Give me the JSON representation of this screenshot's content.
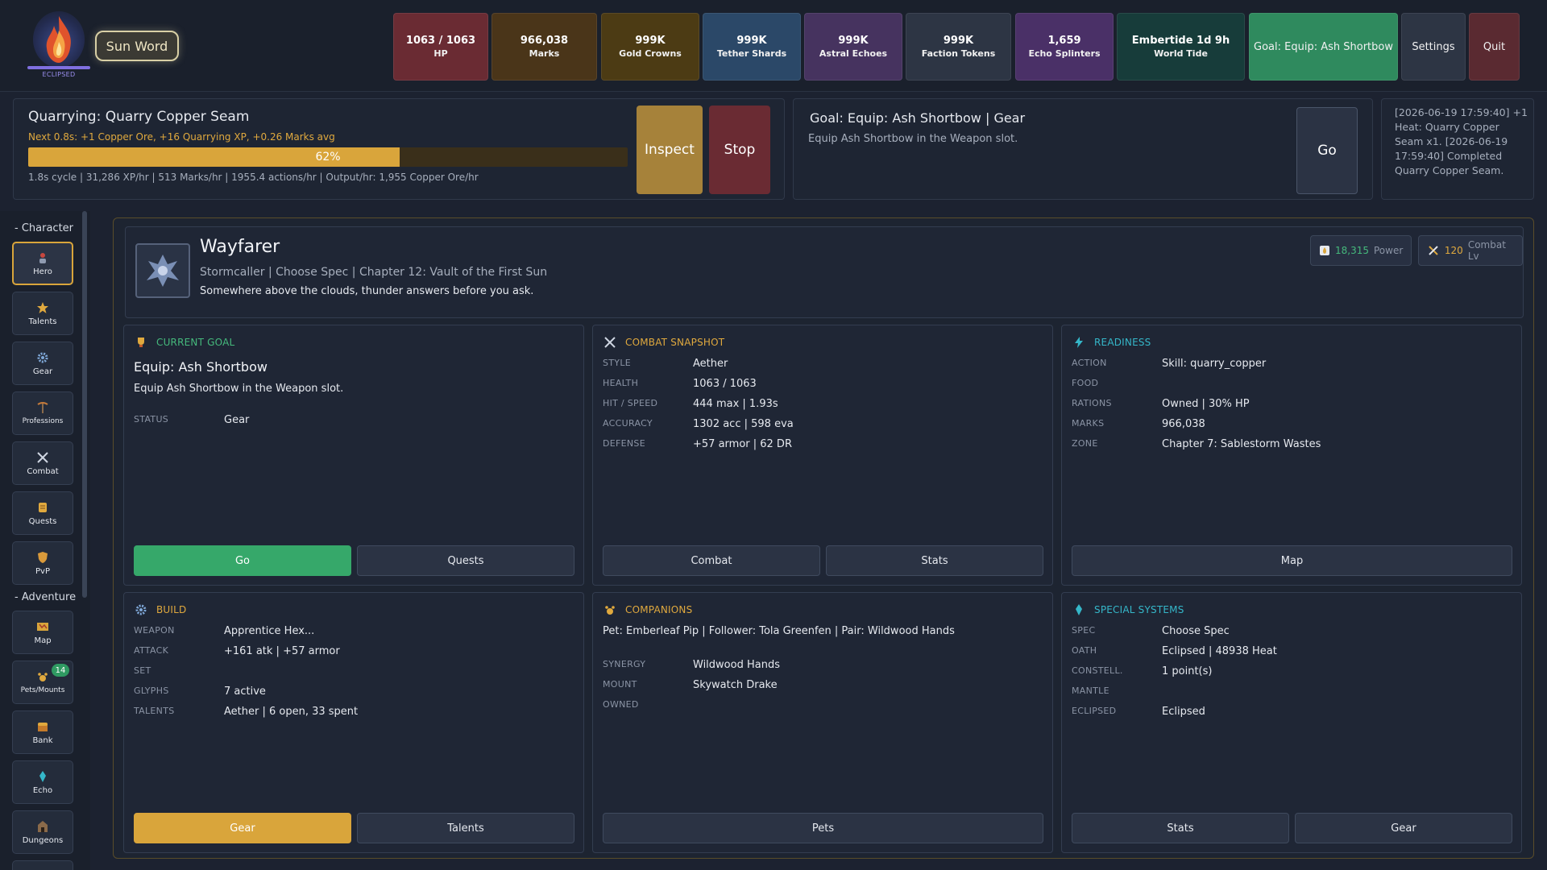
{
  "app": {
    "eclipse_label": "ECLIPSED",
    "sun_word": "Sun Word"
  },
  "stats": [
    {
      "value": "1063 / 1063",
      "label": "HP",
      "color": "#6a2b33"
    },
    {
      "value": "966,038",
      "label": "Marks",
      "color": "#4a3519"
    },
    {
      "value": "999K",
      "label": "Gold Crowns",
      "color": "#4c3b14"
    },
    {
      "value": "999K",
      "label": "Tether Shards",
      "color": "#2b4868"
    },
    {
      "value": "999K",
      "label": "Astral Echoes",
      "color": "#46335f"
    },
    {
      "value": "999K",
      "label": "Faction Tokens",
      "color": "#2d3544"
    },
    {
      "value": "1,659",
      "label": "Echo Splinters",
      "color": "#4a3067"
    },
    {
      "value": "Embertide 1d 9h",
      "label": "World Tide",
      "color": "#173c3a"
    }
  ],
  "topbar": {
    "goal_button": "Goal: Equip: Ash Shortbow",
    "settings": "Settings",
    "quit": "Quit"
  },
  "action": {
    "title": "Quarrying: Quarry Copper Seam",
    "next": "Next 0.8s: +1 Copper Ore, +16 Quarrying XP, +0.26 Marks avg",
    "progress": 0.62,
    "progress_label": "62%",
    "stats": "1.8s cycle | 31,286 XP/hr | 513 Marks/hr | 1955.4 actions/hr | Output/hr: 1,955 Copper Ore/hr",
    "inspect": "Inspect",
    "stop": "Stop"
  },
  "goal_panel": {
    "title": "Goal: Equip: Ash Shortbow | Gear",
    "desc": "Equip Ash Shortbow in the Weapon slot.",
    "go": "Go"
  },
  "log": {
    "text": "[2026-06-19 17:59:40] +1 Heat: Quarry Copper Seam x1. [2026-06-19 17:59:40] Completed Quarry Copper Seam."
  },
  "sidebar": {
    "section_character": "- Character",
    "section_adventure": "- Adventure",
    "items": [
      {
        "label": "Hero",
        "icon": "hero-icon"
      },
      {
        "label": "Talents",
        "icon": "star-icon"
      },
      {
        "label": "Gear",
        "icon": "gear-icon"
      },
      {
        "label": "Professions",
        "icon": "pickaxe-icon"
      },
      {
        "label": "Combat",
        "icon": "crossed-swords-icon"
      },
      {
        "label": "Quests",
        "icon": "scroll-icon"
      },
      {
        "label": "PvP",
        "icon": "shield-icon"
      },
      {
        "label": "Map",
        "icon": "map-icon"
      },
      {
        "label": "Pets/Mounts",
        "icon": "paw-icon",
        "badge": "14"
      },
      {
        "label": "Bank",
        "icon": "chest-icon"
      },
      {
        "label": "Echo",
        "icon": "crystal-icon"
      },
      {
        "label": "Dungeons",
        "icon": "dungeon-icon"
      }
    ]
  },
  "hero": {
    "name": "Wayfarer",
    "subtitle": "Stormcaller | Choose Spec | Chapter 12: Vault of the First Sun",
    "flavor": "Somewhere above the clouds, thunder answers before you ask.",
    "power_value": "18,315",
    "power_label": "Power",
    "combat_value": "120",
    "combat_label": "Combat Lv"
  },
  "cards": {
    "current_goal": {
      "header": "CURRENT GOAL",
      "title": "Equip: Ash Shortbow",
      "desc": "Equip Ash Shortbow in the Weapon slot.",
      "status_key": "STATUS",
      "status_val": "Gear",
      "btn1": "Go",
      "btn2": "Quests"
    },
    "combat": {
      "header": "COMBAT SNAPSHOT",
      "rows": [
        {
          "k": "STYLE",
          "v": "Aether"
        },
        {
          "k": "HEALTH",
          "v": "1063 / 1063"
        },
        {
          "k": "HIT / SPEED",
          "v": "444 max | 1.93s"
        },
        {
          "k": "ACCURACY",
          "v": "1302 acc | 598 eva"
        },
        {
          "k": "DEFENSE",
          "v": "+57 armor | 62 DR"
        }
      ],
      "btn1": "Combat",
      "btn2": "Stats"
    },
    "readiness": {
      "header": "READINESS",
      "rows": [
        {
          "k": "ACTION",
          "v": "Skill: quarry_copper"
        },
        {
          "k": "FOOD",
          "v": ""
        },
        {
          "k": "RATIONS",
          "v": "Owned | 30% HP"
        },
        {
          "k": "MARKS",
          "v": "966,038"
        },
        {
          "k": "ZONE",
          "v": "Chapter 7: Sablestorm Wastes"
        }
      ],
      "btn1": "Map"
    },
    "build": {
      "header": "BUILD",
      "rows": [
        {
          "k": "WEAPON",
          "v": "Apprentice Hex..."
        },
        {
          "k": "ATTACK",
          "v": "+161 atk | +57 armor"
        },
        {
          "k": "SET",
          "v": ""
        },
        {
          "k": "GLYPHS",
          "v": "7 active"
        },
        {
          "k": "TALENTS",
          "v": "Aether | 6 open, 33 spent"
        }
      ],
      "btn1": "Gear",
      "btn2": "Talents"
    },
    "companions": {
      "header": "COMPANIONS",
      "line": "Pet: Emberleaf Pip | Follower: Tola Greenfen | Pair: Wildwood Hands",
      "rows": [
        {
          "k": "SYNERGY",
          "v": "Wildwood Hands"
        },
        {
          "k": "MOUNT",
          "v": "Skywatch Drake"
        },
        {
          "k": "OWNED",
          "v": ""
        }
      ],
      "btn1": "Pets"
    },
    "special": {
      "header": "SPECIAL SYSTEMS",
      "rows": [
        {
          "k": "SPEC",
          "v": "Choose Spec"
        },
        {
          "k": "OATH",
          "v": "Eclipsed | 48938 Heat"
        },
        {
          "k": "CONSTELL.",
          "v": "1 point(s)"
        },
        {
          "k": "MANTLE",
          "v": ""
        },
        {
          "k": "ECLIPSED",
          "v": "Eclipsed"
        }
      ],
      "btn1": "Stats",
      "btn2": "Gear"
    }
  },
  "colors": {
    "accent_gold": "#d9a53b",
    "accent_green": "#36a86a",
    "accent_cyan": "#35b7c9",
    "accent_purple": "#9b8ff0"
  }
}
